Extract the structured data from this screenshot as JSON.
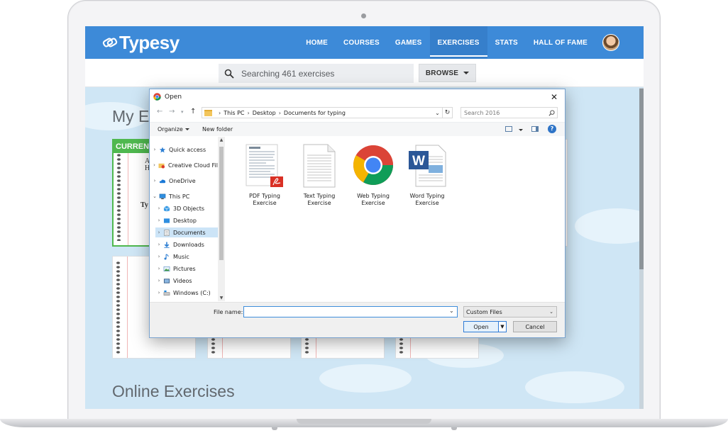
{
  "app": {
    "brand": "Typesy",
    "nav_items": [
      "HOME",
      "COURSES",
      "GAMES",
      "EXERCISES",
      "STATS",
      "HALL OF FAME"
    ],
    "active_nav": "EXERCISES",
    "accent": "#3d8ad8"
  },
  "search": {
    "placeholder": "Searching 461 exercises",
    "browse_label": "BROWSE"
  },
  "sections": {
    "my_exercises_title": "My E",
    "current_badge": "CURREN",
    "notebook_letters": [
      "A",
      "H",
      "Ty"
    ],
    "online_exercises_title": "Online Exercises"
  },
  "dialog": {
    "title": "Open",
    "breadcrumb": [
      "This PC",
      "Desktop",
      "Documents for typing"
    ],
    "search_placeholder": "Search 2016",
    "toolbar": {
      "organize": "Organize",
      "new_folder": "New folder",
      "help": "?"
    },
    "nav_tree": [
      {
        "label": "Quick access",
        "icon": "star-icon",
        "level": 0
      },
      {
        "label": "Creative Cloud Fil",
        "icon": "creative-cloud-icon",
        "level": 0
      },
      {
        "label": "OneDrive",
        "icon": "cloud-icon",
        "level": 0
      },
      {
        "label": "This PC",
        "icon": "computer-icon",
        "level": 0
      },
      {
        "label": "3D Objects",
        "icon": "cube-icon",
        "level": 1
      },
      {
        "label": "Desktop",
        "icon": "desktop-icon",
        "level": 1
      },
      {
        "label": "Documents",
        "icon": "document-icon",
        "level": 1,
        "selected": true
      },
      {
        "label": "Downloads",
        "icon": "download-icon",
        "level": 1
      },
      {
        "label": "Music",
        "icon": "music-icon",
        "level": 1
      },
      {
        "label": "Pictures",
        "icon": "picture-icon",
        "level": 1
      },
      {
        "label": "Videos",
        "icon": "video-icon",
        "level": 1
      },
      {
        "label": "Windows (C:)",
        "icon": "drive-icon",
        "level": 1
      }
    ],
    "files": [
      {
        "name_line1": "PDF Typing",
        "name_line2": "Exercise",
        "icon": "pdf-file-icon"
      },
      {
        "name_line1": "Text Typing",
        "name_line2": "Exercise",
        "icon": "text-file-icon"
      },
      {
        "name_line1": "Web Typing",
        "name_line2": "Exercise",
        "icon": "chrome-icon"
      },
      {
        "name_line1": "Word Typing",
        "name_line2": "Exercise",
        "icon": "word-icon"
      }
    ],
    "file_name_label": "File name:",
    "file_name_value": "",
    "filter": "Custom Files",
    "open_label": "Open",
    "cancel_label": "Cancel"
  }
}
